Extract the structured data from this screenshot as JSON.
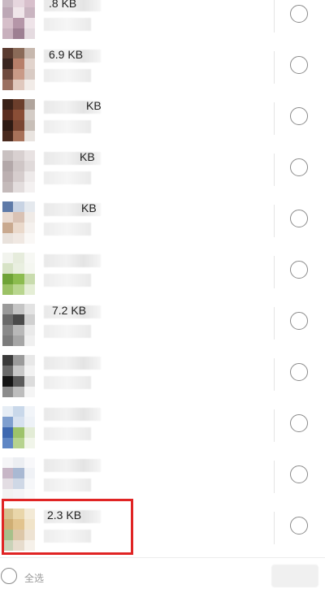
{
  "files": [
    {
      "size_text": ".8 KB",
      "tiles": [
        "#c9b9c3",
        "#e6d6de",
        "#d8c0cc",
        "#bda8b6",
        "#f0e6ea",
        "#cab5c1",
        "#d6bfca",
        "#b596a8",
        "#efe4e9",
        "#c8b0bd",
        "#9d7f92",
        "#e5dbe0"
      ]
    },
    {
      "size_text": "6.9 KB",
      "tiles": [
        "#5a3b30",
        "#8a6a58",
        "#c7b8ae",
        "#3a2620",
        "#b77f6a",
        "#e2d4cd",
        "#6e4a3e",
        "#c99a87",
        "#d9cbc4",
        "#9a6f60",
        "#e0c8bd",
        "#f2ece8"
      ]
    },
    {
      "size_text": "KB",
      "tiles": [
        "#3b2218",
        "#6b3e2b",
        "#b0a49c",
        "#5a2d1f",
        "#8a4e36",
        "#d4ccc6",
        "#2e1a13",
        "#7a4632",
        "#c8bfb8",
        "#4a2a1e",
        "#a8725a",
        "#e9e4e0"
      ]
    },
    {
      "size_text": "KB",
      "tiles": [
        "#c9c1c1",
        "#d8d0d0",
        "#e8e2e2",
        "#b3a8a9",
        "#cfc6c6",
        "#e0dada",
        "#bcb0b1",
        "#d6cdcd",
        "#eeeaea",
        "#c4baba",
        "#e3dddd",
        "#f4f1f1"
      ]
    },
    {
      "size_text": "KB",
      "tiles": [
        "#5e7aa8",
        "#c8d3e3",
        "#e5e9ee",
        "#e8d9cf",
        "#d9c2b4",
        "#f0ebe7",
        "#c9a98f",
        "#ead9cb",
        "#f5f1ee",
        "#e9e2dc",
        "#f0e8e2",
        "#faf8f6"
      ]
    },
    {
      "size_text": "",
      "tiles": [
        "#f2f4ee",
        "#e6ecdc",
        "#f7f8f4",
        "#d7e3c6",
        "#e9efe0",
        "#f5f7f1",
        "#6fa337",
        "#8cbc4f",
        "#c9dcae",
        "#9cc266",
        "#b9d68f",
        "#e5eed6"
      ]
    },
    {
      "size_text": "7.2 KB",
      "tiles": [
        "#9a9a9a",
        "#c5c5c5",
        "#e3e3e3",
        "#6a6a6a",
        "#4a4a4a",
        "#d0d0d0",
        "#8a8a8a",
        "#b8b8b8",
        "#eaeaea",
        "#7c7c7c",
        "#a6a6a6",
        "#f0f0f0"
      ]
    },
    {
      "size_text": "",
      "tiles": [
        "#3a3a3a",
        "#9a9a9a",
        "#e8e8e8",
        "#6a6a6a",
        "#c8c8c8",
        "#f2f2f2",
        "#141414",
        "#5a5a5a",
        "#dcdcdc",
        "#8c8c8c",
        "#bdbdbd",
        "#f5f5f5"
      ]
    },
    {
      "size_text": "",
      "tiles": [
        "#e6edf5",
        "#c9d8ea",
        "#f2f5f9",
        "#7f9fcf",
        "#d6e1ef",
        "#eef2f7",
        "#3e68b0",
        "#9dc36a",
        "#e3ecd6",
        "#5f86c4",
        "#b6d38e",
        "#f1f5ea"
      ]
    },
    {
      "size_text": "",
      "tiles": [
        "#f5f5f7",
        "#eceef2",
        "#f8f8fa",
        "#c7b6c6",
        "#a9b9d3",
        "#f0f2f6",
        "#e3dde3",
        "#cfd8e6",
        "#f6f7f9",
        "#f2f2f2",
        "#f4f4f6",
        "#fafafa"
      ]
    },
    {
      "size_text": "2.3 KB",
      "tiles": [
        "#d7c08e",
        "#e9d6aa",
        "#f3ead6",
        "#cfae74",
        "#e2c48e",
        "#f1e4c9",
        "#a7c08a",
        "#ddc7a8",
        "#eee3d3",
        "#c9d2b8",
        "#e7dccd",
        "#f6f1ea"
      ]
    }
  ],
  "bottom_bar": {
    "select_all_label": "全选"
  },
  "colors": {
    "highlight": "#e02424",
    "radio_border": "#8a8a8a"
  }
}
